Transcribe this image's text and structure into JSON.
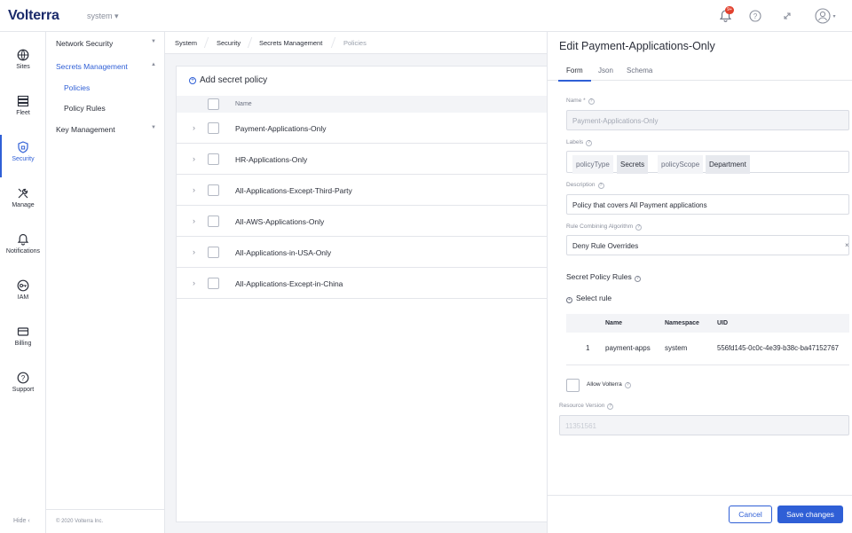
{
  "app": {
    "logo_text": "Volterra",
    "namespace": "system"
  },
  "topbar": {
    "notification_badge": "9+"
  },
  "rail": {
    "items": [
      {
        "label": "Sites",
        "icon": "globe-icon"
      },
      {
        "label": "Fleet",
        "icon": "fleet-icon"
      },
      {
        "label": "Security",
        "icon": "shield-icon"
      },
      {
        "label": "Manage",
        "icon": "tools-icon"
      },
      {
        "label": "Notifications",
        "icon": "bell-icon"
      },
      {
        "label": "IAM",
        "icon": "key-icon"
      },
      {
        "label": "Billing",
        "icon": "card-icon"
      },
      {
        "label": "Support",
        "icon": "help-icon"
      }
    ],
    "active": "Security",
    "hide_label": "Hide"
  },
  "subnav": {
    "items": [
      {
        "label": "Network Security"
      },
      {
        "label": "Secrets Management"
      },
      {
        "label": "Policies"
      },
      {
        "label": "Policy Rules"
      },
      {
        "label": "Key Management"
      }
    ],
    "copyright": "© 2020 Volterra Inc."
  },
  "breadcrumb": [
    "System",
    "Security",
    "Secrets Management",
    "Policies"
  ],
  "list": {
    "add_label": "Add secret policy",
    "column_name": "Name",
    "rows": [
      "Payment-Applications-Only",
      "HR-Applications-Only",
      "All-Applications-Except-Third-Party",
      "All-AWS-Applications-Only",
      "All-Applications-in-USA-Only",
      "All-Applications-Except-in-China"
    ]
  },
  "panel": {
    "title": "Edit Payment-Applications-Only",
    "tabs": [
      "Form",
      "Json",
      "Schema"
    ],
    "active_tab": "Form",
    "name_label": "Name *",
    "name_value": "Payment-Applications-Only",
    "labels_label": "Labels",
    "labels": [
      {
        "key": "policyType",
        "value": "Secrets"
      },
      {
        "key": "policyScope",
        "value": "Department"
      }
    ],
    "description_label": "Description",
    "description_value": "Policy that covers All Payment applications",
    "algorithm_label": "Rule Combining Algorithm",
    "algorithm_value": "Deny Rule Overrides",
    "rules_title": "Secret Policy Rules",
    "select_rule_label": "Select rule",
    "rules_columns": [
      "Name",
      "Namespace",
      "UID"
    ],
    "rules": [
      {
        "index": "1",
        "name": "payment-apps",
        "namespace": "system",
        "uid": "556fd145-0c0c-4e39-b38c-ba47152767"
      }
    ],
    "allow_label": "Allow Volterra",
    "resource_version_label": "Resource Version",
    "resource_version_value": "11351561",
    "cancel_label": "Cancel",
    "save_label": "Save changes"
  }
}
